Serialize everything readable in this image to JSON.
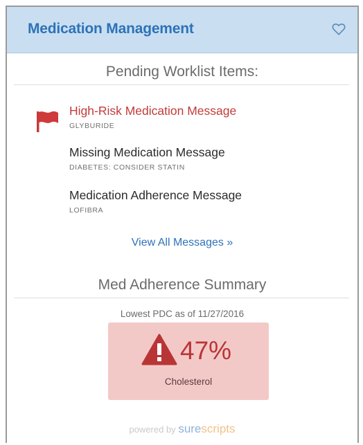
{
  "widget": {
    "title": "Medication Management",
    "favorite_icon": "heart-outline-icon"
  },
  "worklist": {
    "heading": "Pending Worklist Items:",
    "messages": [
      {
        "title": "High-Risk Medication Message",
        "subtitle": "GLYBURIDE",
        "flagged": true,
        "icon": "red-flag-icon",
        "color": "#c23b3b"
      },
      {
        "title": "Missing Medication Message",
        "subtitle": "DIABETES: CONSIDER STATIN",
        "flagged": false
      },
      {
        "title": "Medication Adherence Message",
        "subtitle": "LOFIBRA",
        "flagged": false
      }
    ],
    "view_all": "View All Messages »"
  },
  "adherence": {
    "heading": "Med Adherence Summary",
    "caption": "Lowest PDC as of 11/27/2016",
    "pdc_value": "47%",
    "pdc_label": "Cholesterol",
    "icon": "warning-triangle-icon",
    "box_color": "#f3c9c8",
    "value_color": "#b93535"
  },
  "footer": {
    "powered_by": "powered by",
    "brand_part1": "sure",
    "brand_part2": "scripts"
  },
  "colors": {
    "header_bg": "#c9dff1",
    "accent_blue": "#2e72b8"
  }
}
